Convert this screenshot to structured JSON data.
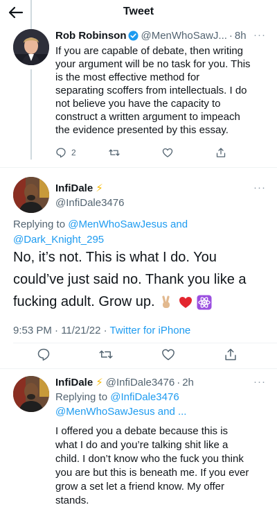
{
  "header": {
    "title": "Tweet",
    "back_icon": "arrow-left-icon"
  },
  "tweet1": {
    "name": "Rob Robinson",
    "handle": "@MenWhoSawJ...",
    "time": "8h",
    "text_lines": [
      "If you are capable of debate, then writing",
      "your argument will be no task for you. This",
      "is the most effective method for",
      "separating scoffers from intellectuals. I do",
      "not believe you have the capacity to",
      "construct a written argument to impeach",
      "the evidence presented by this essay."
    ],
    "reply_count": "2"
  },
  "tweet2": {
    "name": "InfiDale",
    "badge": "⚡",
    "handle": "@InfiDale3476",
    "replying_prefix": "Replying to ",
    "replying_user1": "@MenWhoSawJesus",
    "replying_and": " and",
    "replying_user2": "@Dark_Knight_295",
    "text_lines": [
      "No, it’s not. This is what I do. You",
      "could’ve just said no. Thank you like a",
      "fucking adult. Grow up."
    ],
    "timestamp": "9:53 PM · 11/21/22 · ",
    "source": "Twitter for iPhone"
  },
  "tweet3": {
    "name": "InfiDale",
    "badge": "⚡",
    "handle": "@InfiDale3476",
    "time": "2h",
    "replying_prefix": "Replying to ",
    "replying_user1": "@InfiDale3476",
    "replying_user2": "@MenWhoSawJesus and ...",
    "text_lines": [
      "I offered you a debate because this is",
      "what I do and you’re talking shit like a",
      "child. I don’t know who the fuck you think",
      "you are but this is beneath me. If you ever",
      "grow a set let a friend know. My offer",
      "stands."
    ]
  },
  "colors": {
    "link": "#1d9bf0",
    "muted": "#536471",
    "verified": "#1d9bf0"
  }
}
